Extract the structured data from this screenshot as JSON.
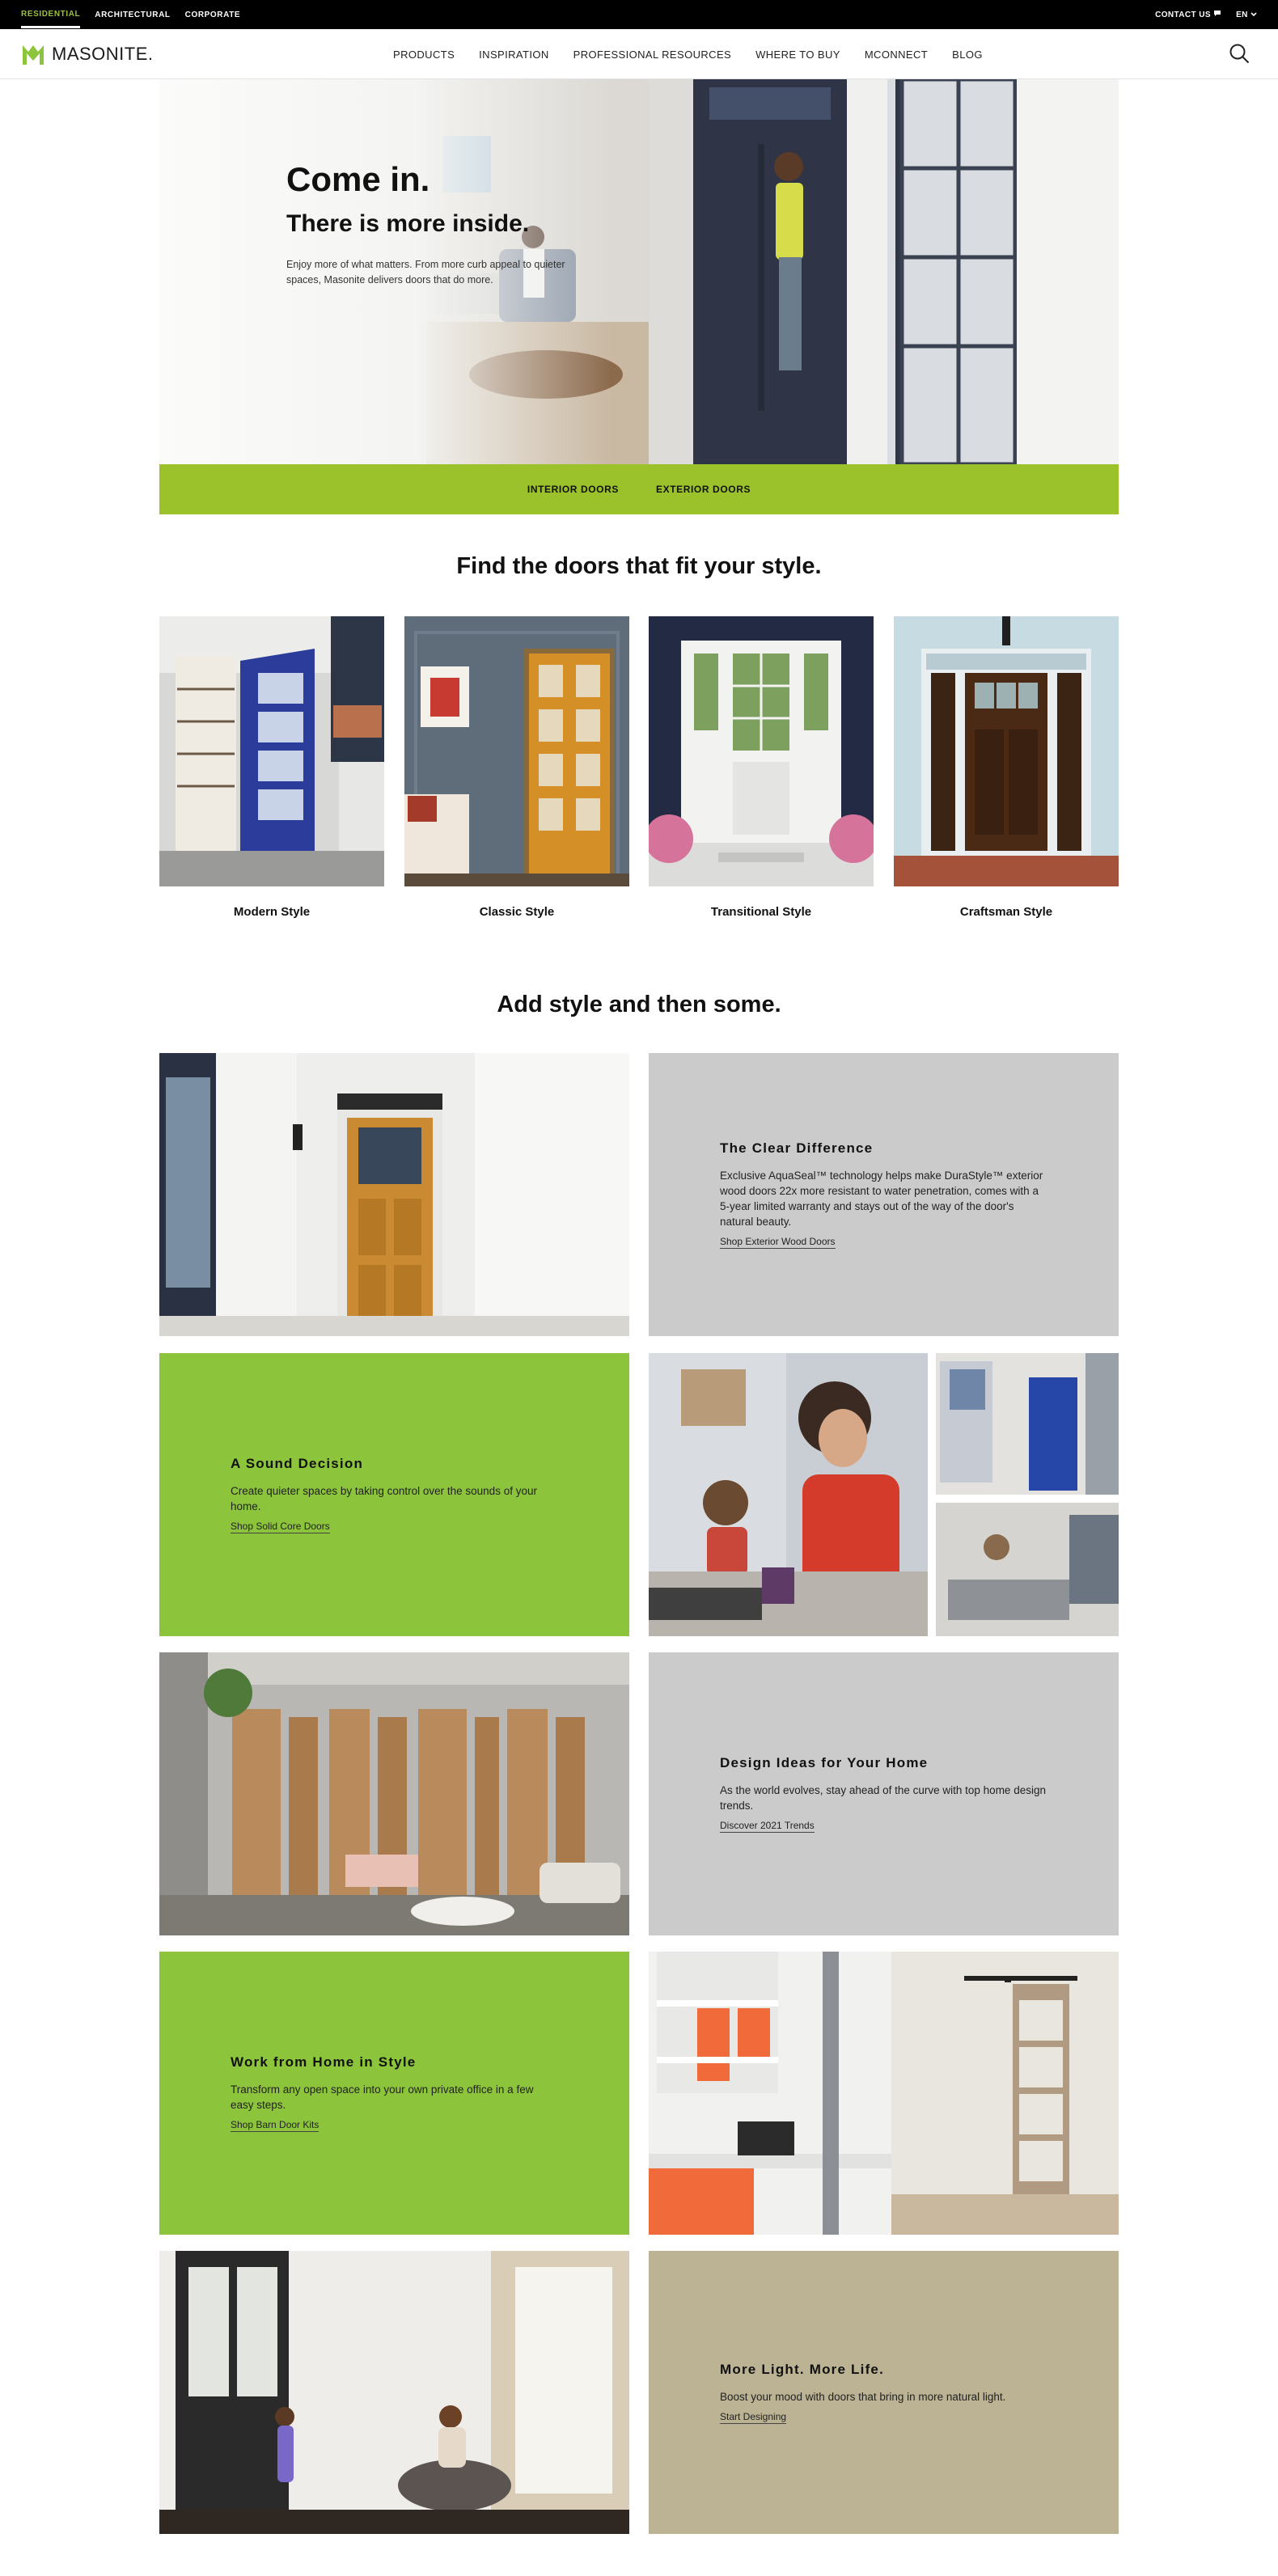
{
  "topbar": {
    "links": [
      "RESIDENTIAL",
      "ARCHITECTURAL",
      "CORPORATE"
    ],
    "contact": "CONTACT US",
    "language": "EN"
  },
  "nav": {
    "brand": "MASONITE.",
    "items": [
      "PRODUCTS",
      "INSPIRATION",
      "PROFESSIONAL RESOURCES",
      "WHERE TO BUY",
      "MCONNECT",
      "BLOG"
    ]
  },
  "hero": {
    "title": "Come in.",
    "subtitle": "There is more  inside.",
    "body": "Enjoy more of what matters. From more curb appeal to quieter spaces, Masonite delivers doors that do more."
  },
  "subnav": {
    "interior": "INTERIOR DOORS",
    "exterior": "EXTERIOR DOORS"
  },
  "styles": {
    "title": "Find the doors that fit your style.",
    "items": [
      "Modern Style",
      "Classic Style",
      "Transitional Style",
      "Craftsman Style"
    ]
  },
  "features": {
    "title": "Add style and then some.",
    "clear": {
      "title": "The Clear Difference",
      "body": "Exclusive AquaSeal™ technology helps make DuraStyle™ exterior wood doors 22x more resistant to water penetration, comes with a 5-year limited warranty and stays out of the way of the door's natural beauty.",
      "link": "Shop Exterior Wood Doors"
    },
    "sound": {
      "title": "A Sound Decision",
      "body": "Create quieter spaces by taking control over the sounds of your home.",
      "link": "Shop Solid Core Doors"
    },
    "design": {
      "title": "Design Ideas for Your Home",
      "body": "As the world evolves, stay ahead of the curve with top home design trends.",
      "link": "Discover 2021 Trends"
    },
    "work": {
      "title": "Work from Home in Style",
      "body": "Transform any open space into your own private office in a few easy steps.",
      "link": "Shop Barn Door Kits"
    },
    "light": {
      "title": "More Light. More Life.",
      "body": "Boost your mood with doors that bring in more natural light.",
      "link": "Start Designing"
    }
  },
  "colors": {
    "brand_green": "#9bc22a",
    "tile_green": "#8cc43c",
    "tile_gray": "#cbcbcb",
    "tile_tan": "#bbb394"
  }
}
